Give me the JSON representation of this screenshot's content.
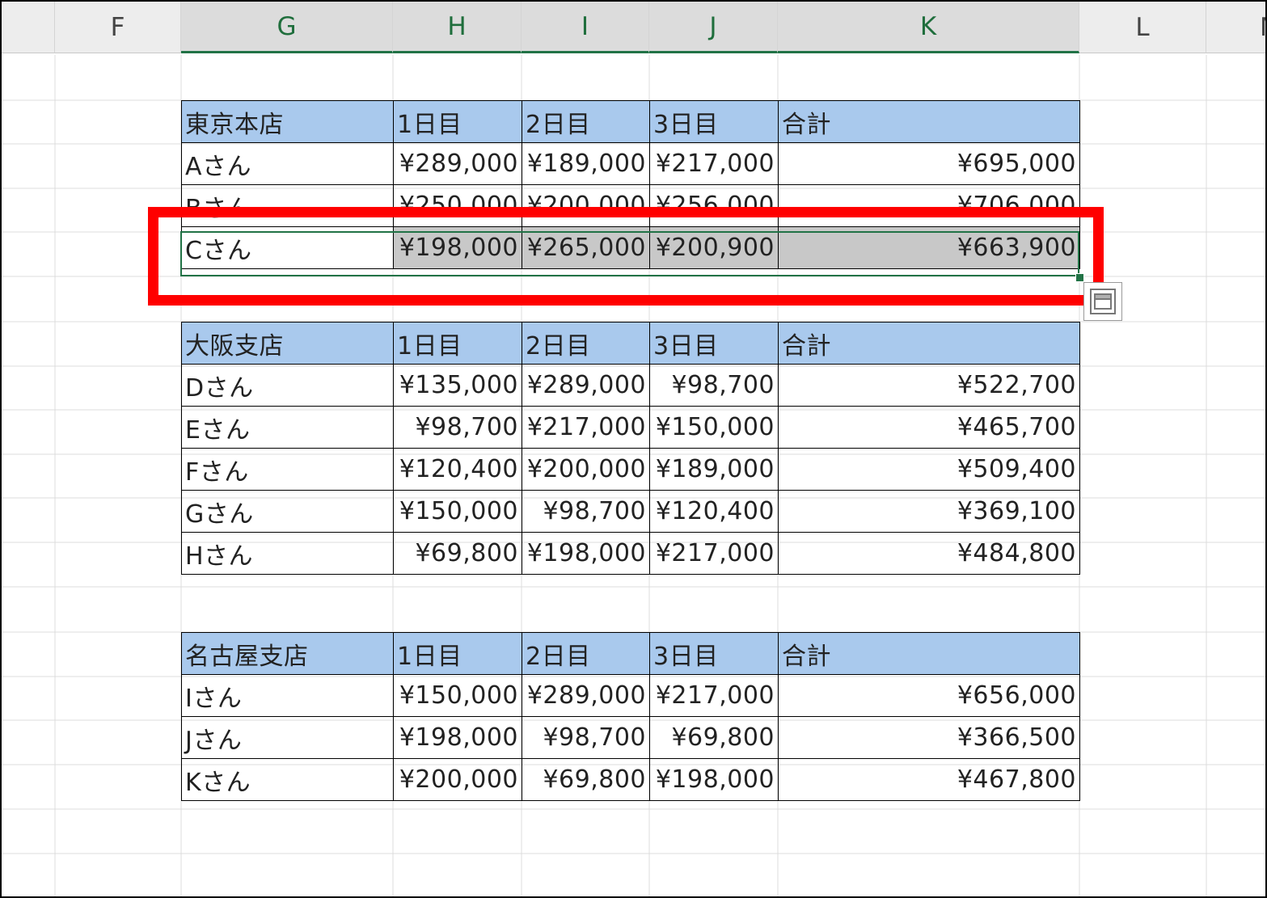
{
  "columns": [
    "F",
    "G",
    "H",
    "I",
    "J",
    "K",
    "L",
    "M"
  ],
  "selected_columns": [
    "G",
    "H",
    "I",
    "J",
    "K"
  ],
  "icons": {
    "quick_analysis": "quick-analysis-icon"
  },
  "colors": {
    "header_fill": "#a9c9ed",
    "selected_fill": "#c8c8c8",
    "selection_green": "#217346",
    "highlight_red": "#ff0000"
  },
  "tables": [
    {
      "branch": "東京本店",
      "headers": [
        "1日目",
        "2日目",
        "3日目",
        "合計"
      ],
      "rows": [
        {
          "name": "Aさん",
          "values": [
            "¥289,000",
            "¥189,000",
            "¥217,000",
            "¥695,000"
          ]
        },
        {
          "name": "Bさん",
          "values": [
            "¥250,000",
            "¥200,000",
            "¥256,000",
            "¥706,000"
          ]
        },
        {
          "name": "Cさん",
          "values": [
            "¥198,000",
            "¥265,000",
            "¥200,900",
            "¥663,900"
          ]
        }
      ]
    },
    {
      "branch": "大阪支店",
      "headers": [
        "1日目",
        "2日目",
        "3日目",
        "合計"
      ],
      "rows": [
        {
          "name": "Dさん",
          "values": [
            "¥135,000",
            "¥289,000",
            "¥98,700",
            "¥522,700"
          ]
        },
        {
          "name": "Eさん",
          "values": [
            "¥98,700",
            "¥217,000",
            "¥150,000",
            "¥465,700"
          ]
        },
        {
          "name": "Fさん",
          "values": [
            "¥120,400",
            "¥200,000",
            "¥189,000",
            "¥509,400"
          ]
        },
        {
          "name": "Gさん",
          "values": [
            "¥150,000",
            "¥98,700",
            "¥120,400",
            "¥369,100"
          ]
        },
        {
          "name": "Hさん",
          "values": [
            "¥69,800",
            "¥198,000",
            "¥217,000",
            "¥484,800"
          ]
        }
      ]
    },
    {
      "branch": "名古屋支店",
      "headers": [
        "1日目",
        "2日目",
        "3日目",
        "合計"
      ],
      "rows": [
        {
          "name": "Iさん",
          "values": [
            "¥150,000",
            "¥289,000",
            "¥217,000",
            "¥656,000"
          ]
        },
        {
          "name": "Jさん",
          "values": [
            "¥198,000",
            "¥98,700",
            "¥69,800",
            "¥366,500"
          ]
        },
        {
          "name": "Kさん",
          "values": [
            "¥200,000",
            "¥69,800",
            "¥198,000",
            "¥467,800"
          ]
        }
      ]
    }
  ]
}
